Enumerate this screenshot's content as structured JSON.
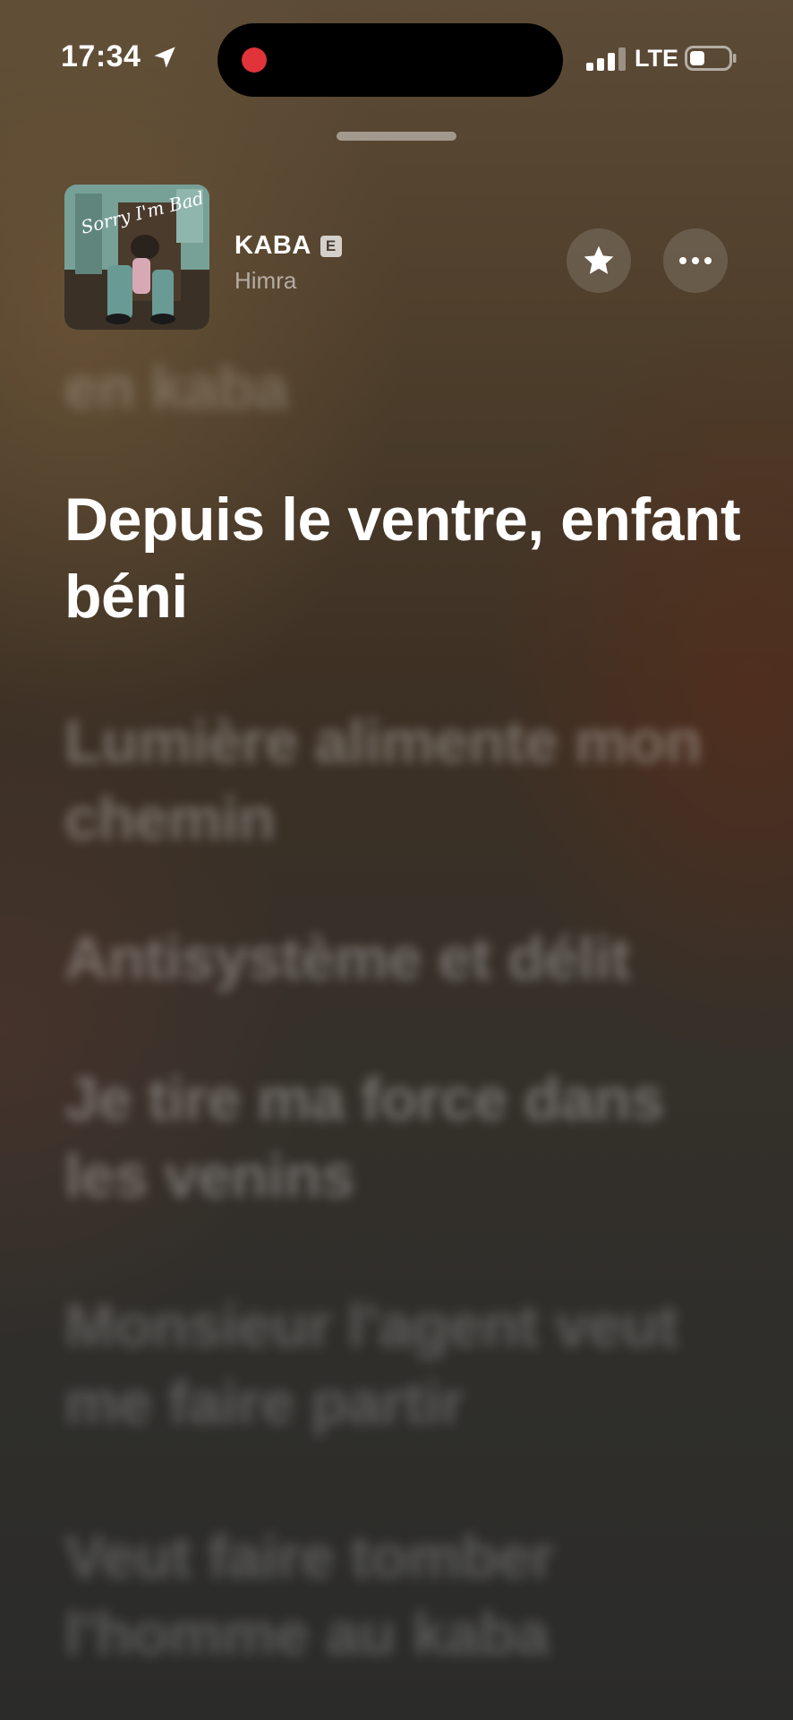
{
  "status_bar": {
    "time": "17:34",
    "network": "LTE",
    "icons": [
      "location-arrow-icon",
      "recording-dot-icon",
      "signal-bars-icon",
      "battery-icon"
    ]
  },
  "now_playing": {
    "title": "KABA",
    "explicit_badge": "E",
    "artist": "Himra",
    "album_art_text": "Sorry I'm Bad",
    "favorite_icon": "star-icon",
    "more_icon": "ellipsis-icon"
  },
  "lyrics": {
    "previous_line": "en kaba",
    "current_line": "Depuis le ventre, enfant béni",
    "upcoming": [
      "Lumière alimente mon chemin",
      "Antisystème et délit",
      "Je tire ma force dans les venins",
      "Monsieur l'agent veut me faire partir",
      "Veut faire tomber l'homme au kaba"
    ]
  },
  "colors": {
    "recording_dot": "#e0333a",
    "background_top": "#5c4b36",
    "background_bottom": "#2b2b29"
  }
}
